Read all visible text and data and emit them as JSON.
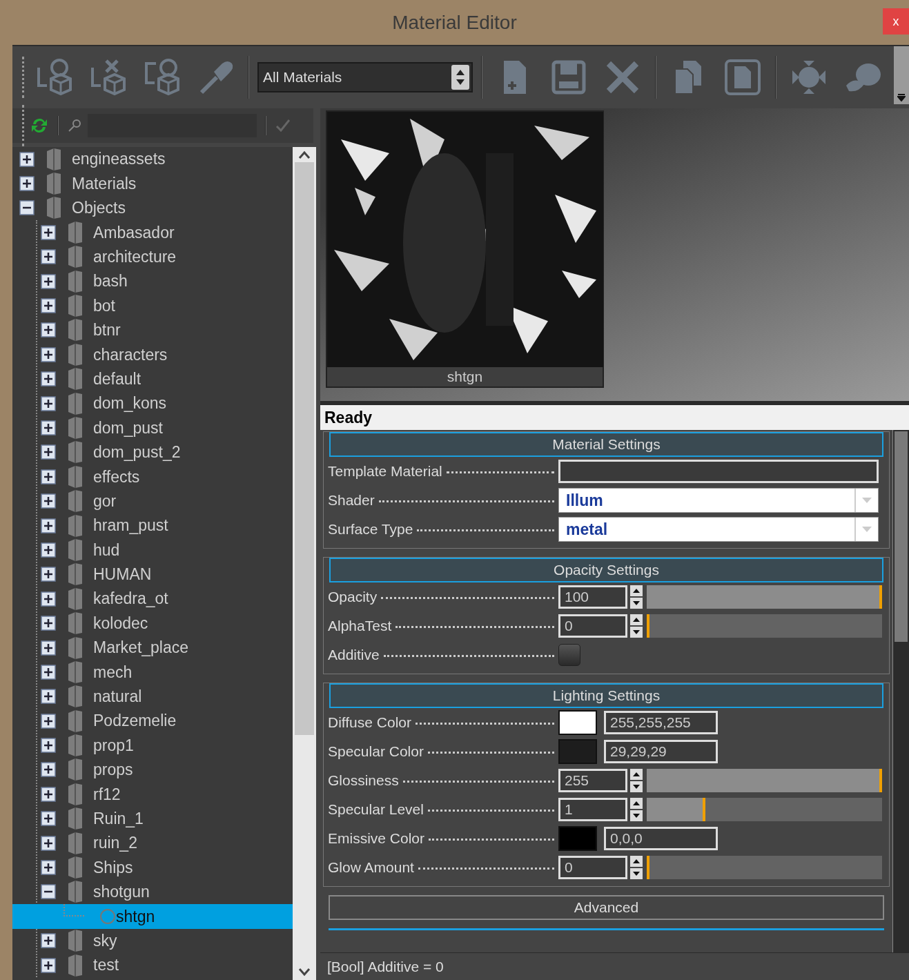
{
  "window": {
    "title": "Material Editor",
    "close": "x"
  },
  "toolbar": {
    "filter": {
      "value": "All Materials"
    }
  },
  "tree": [
    {
      "label": "engineassets",
      "kind": "folder",
      "expanded": false,
      "selected": false
    },
    {
      "label": "Materials",
      "kind": "folder",
      "expanded": false,
      "selected": false
    },
    {
      "label": "Objects",
      "kind": "folder",
      "expanded": true,
      "selected": false,
      "children": [
        {
          "label": "Ambasador",
          "kind": "folder",
          "expanded": false,
          "selected": false
        },
        {
          "label": "architecture",
          "kind": "folder",
          "expanded": false,
          "selected": false
        },
        {
          "label": "bash",
          "kind": "folder",
          "expanded": false,
          "selected": false
        },
        {
          "label": "bot",
          "kind": "folder",
          "expanded": false,
          "selected": false
        },
        {
          "label": "btnr",
          "kind": "folder",
          "expanded": false,
          "selected": false
        },
        {
          "label": "characters",
          "kind": "folder",
          "expanded": false,
          "selected": false
        },
        {
          "label": "default",
          "kind": "folder",
          "expanded": false,
          "selected": false
        },
        {
          "label": "dom_kons",
          "kind": "folder",
          "expanded": false,
          "selected": false
        },
        {
          "label": "dom_pust",
          "kind": "folder",
          "expanded": false,
          "selected": false
        },
        {
          "label": "dom_pust_2",
          "kind": "folder",
          "expanded": false,
          "selected": false
        },
        {
          "label": "effects",
          "kind": "folder",
          "expanded": false,
          "selected": false
        },
        {
          "label": "gor",
          "kind": "folder",
          "expanded": false,
          "selected": false
        },
        {
          "label": "hram_pust",
          "kind": "folder",
          "expanded": false,
          "selected": false
        },
        {
          "label": "hud",
          "kind": "folder",
          "expanded": false,
          "selected": false
        },
        {
          "label": "HUMAN",
          "kind": "folder",
          "expanded": false,
          "selected": false
        },
        {
          "label": "kafedra_ot",
          "kind": "folder",
          "expanded": false,
          "selected": false
        },
        {
          "label": "kolodec",
          "kind": "folder",
          "expanded": false,
          "selected": false
        },
        {
          "label": "Market_place",
          "kind": "folder",
          "expanded": false,
          "selected": false
        },
        {
          "label": "mech",
          "kind": "folder",
          "expanded": false,
          "selected": false
        },
        {
          "label": "natural",
          "kind": "folder",
          "expanded": false,
          "selected": false
        },
        {
          "label": "Podzemelie",
          "kind": "folder",
          "expanded": false,
          "selected": false
        },
        {
          "label": "prop1",
          "kind": "folder",
          "expanded": false,
          "selected": false
        },
        {
          "label": "props",
          "kind": "folder",
          "expanded": false,
          "selected": false
        },
        {
          "label": "rf12",
          "kind": "folder",
          "expanded": false,
          "selected": false
        },
        {
          "label": "Ruin_1",
          "kind": "folder",
          "expanded": false,
          "selected": false
        },
        {
          "label": "ruin_2",
          "kind": "folder",
          "expanded": false,
          "selected": false
        },
        {
          "label": "Ships",
          "kind": "folder",
          "expanded": false,
          "selected": false
        },
        {
          "label": "shotgun",
          "kind": "folder",
          "expanded": true,
          "selected": false,
          "children": [
            {
              "label": "shtgn",
              "kind": "material",
              "selected": true
            }
          ]
        },
        {
          "label": "sky",
          "kind": "folder",
          "expanded": false,
          "selected": false
        },
        {
          "label": "test",
          "kind": "folder",
          "expanded": false,
          "selected": false
        }
      ]
    }
  ],
  "preview": {
    "kind": "picture",
    "label": "shtgn"
  },
  "status": "Ready",
  "sections": [
    {
      "title": "Material Settings",
      "expanded": true,
      "rows": [
        {
          "kind": "text",
          "label": "Template Material"
        },
        {
          "kind": "dropdown",
          "label": "Shader",
          "value": "Illum"
        },
        {
          "kind": "dropdown",
          "label": "Surface Type",
          "value": "metal"
        }
      ]
    },
    {
      "title": "Opacity Settings",
      "expanded": true,
      "rows": [
        {
          "kind": "spinner",
          "label": "Opacity",
          "value": "100",
          "level": 1
        },
        {
          "kind": "spinner",
          "label": "AlphaTest",
          "value": "0",
          "level": 0
        },
        {
          "kind": "checkbox",
          "label": "Additive",
          "checked": false
        }
      ]
    },
    {
      "title": "Lighting Settings",
      "expanded": true,
      "rows": [
        {
          "kind": "color",
          "label": "Diffuse Color",
          "value": "255,255,255",
          "color": "#ffffff"
        },
        {
          "kind": "color",
          "label": "Specular Color",
          "value": "29,29,29",
          "color": "#1d1d1d"
        },
        {
          "kind": "spinner",
          "label": "Glossiness",
          "value": "255",
          "level": 1
        },
        {
          "kind": "spinner",
          "label": "Specular Level",
          "value": "1",
          "level": 0.25
        },
        {
          "kind": "color",
          "label": "Emissive Color",
          "value": "0,0,0",
          "color": "#000000"
        },
        {
          "kind": "spinner",
          "label": "Glow Amount",
          "value": "0",
          "level": 0
        }
      ]
    },
    {
      "title": "Advanced",
      "expanded": false
    }
  ],
  "footer": "[Bool] Additive = 0"
}
